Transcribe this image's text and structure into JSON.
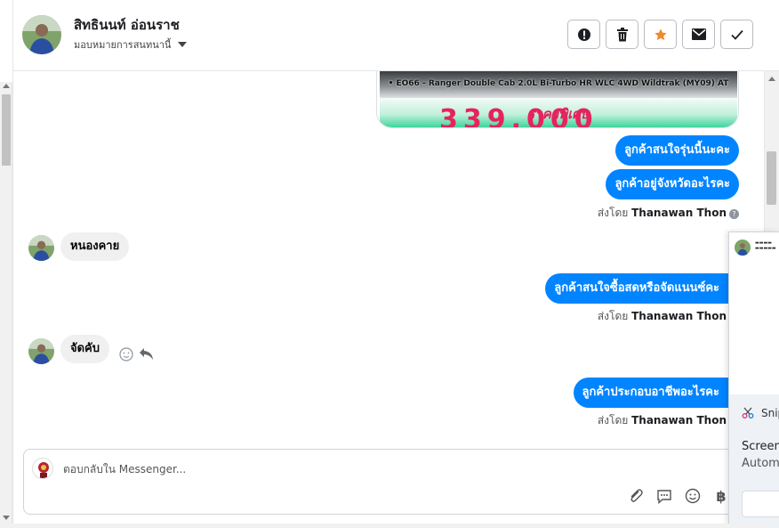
{
  "header": {
    "contact_name": "สิทธินนท์ อ่อนราช",
    "assign_label": "มอบหมายการสนทนานี้",
    "actions": [
      {
        "name": "spam-button",
        "icon": "alert-circle-icon"
      },
      {
        "name": "delete-button",
        "icon": "trash-icon"
      },
      {
        "name": "star-button",
        "icon": "star-icon"
      },
      {
        "name": "mark-unread-button",
        "icon": "envelope-icon"
      },
      {
        "name": "mark-done-button",
        "icon": "check-icon"
      }
    ],
    "star_color": "#f0892b"
  },
  "image_card": {
    "model_line": "• EO66 - Ranger Double Cab 2.0L Bi-Turbo HR WLC 4WD Wildtrak (MY09) AT",
    "promo_title": "ราคาพิเศษ",
    "price": "339,000"
  },
  "messages": {
    "out_1": "ลูกค้าสนใจรุ่นนี้นะคะ",
    "out_2": "ลูกค้าอยู่จังหวัดอะไรคะ",
    "in_1": "หนองคาย",
    "out_3": "ลูกค้าสนใจซื้อสดหรือจัดแนนซ์คะ",
    "in_2": "จัดคับ",
    "out_4": "ลูกค้าประกอบอาชีพอะไรคะ"
  },
  "sent_by": {
    "prefix": "ส่งโดย",
    "agent": "Thanawan Thon"
  },
  "composer": {
    "placeholder": "ตอบกลับใน Messenger..."
  },
  "popup": {
    "snip_label": "Snip",
    "screen_label": "Screen",
    "auto_label": "Autom"
  },
  "colors": {
    "outgoing_bubble": "#0084ff",
    "incoming_bubble": "#f0f0f0"
  }
}
